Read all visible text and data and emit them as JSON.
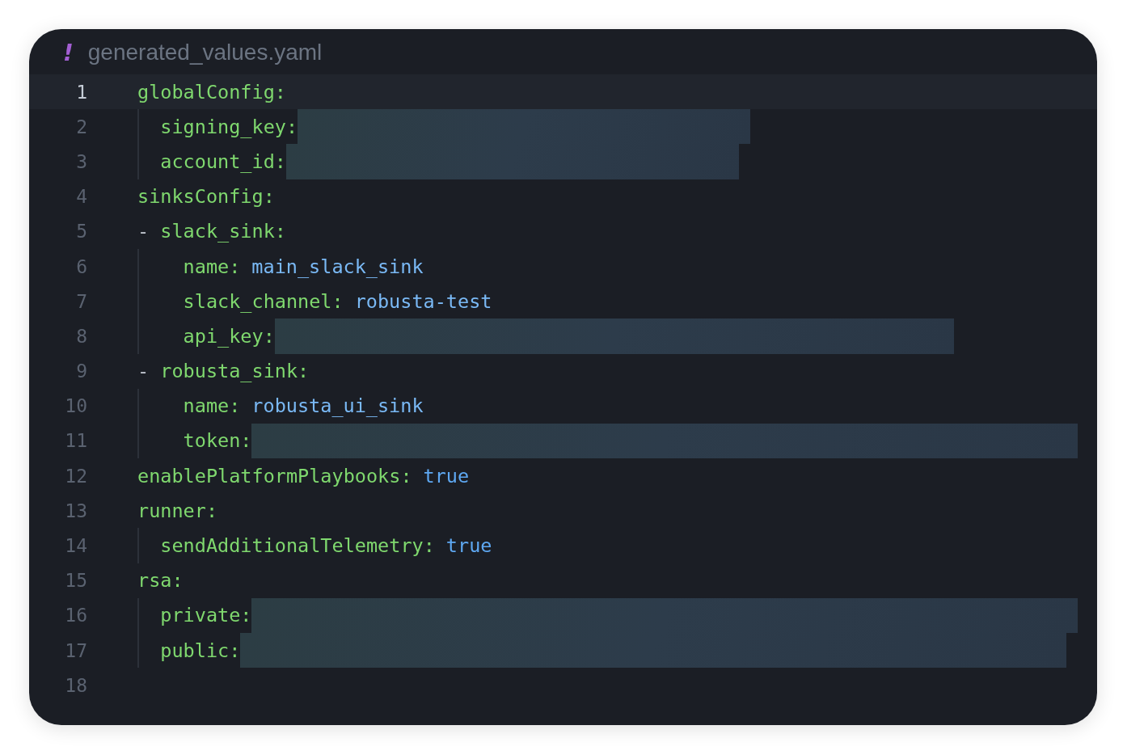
{
  "tab": {
    "icon": "!",
    "title": "generated_values.yaml"
  },
  "lines": [
    {
      "number": "1",
      "key": "globalConfig:",
      "current": true,
      "children": [
        {
          "number": "2",
          "key": "signing_key:",
          "kind": "short",
          "redacted": true,
          "current": false
        },
        {
          "number": "3",
          "key": "account_id:",
          "kind": "short",
          "redacted": true,
          "current": false
        }
      ]
    },
    {
      "number": "4",
      "key": "sinksConfig:",
      "current": false,
      "children": [
        {
          "number": "5",
          "dash": "-",
          "key": "slack_sink:",
          "current": false,
          "children": [
            {
              "number": "6",
              "key": "name:",
              "value": "main_slack_sink",
              "current": false
            },
            {
              "number": "7",
              "key": "slack_channel:",
              "value": "robusta-test",
              "current": false
            },
            {
              "number": "8",
              "key": "api_key:",
              "kind": "medium",
              "redacted": true,
              "current": false
            }
          ]
        },
        {
          "number": "9",
          "dash": "-",
          "key": "robusta_sink:",
          "current": false,
          "children": [
            {
              "number": "10",
              "key": "name:",
              "value": "robusta_ui_sink",
              "current": false
            },
            {
              "number": "11",
              "key": "token:",
              "kind": "long",
              "redacted": true,
              "current": false
            }
          ]
        }
      ]
    },
    {
      "number": "12",
      "key": "enablePlatformPlaybooks:",
      "value": "true",
      "current": false
    },
    {
      "number": "13",
      "key": "runner:",
      "current": false,
      "children": [
        {
          "number": "14",
          "key": "sendAdditionalTelemetry:",
          "value": "true",
          "current": false
        }
      ]
    },
    {
      "number": "15",
      "key": "rsa:",
      "current": false,
      "children": [
        {
          "number": "16",
          "key": "private:",
          "kind": "long",
          "redacted": true,
          "current": false
        },
        {
          "number": "17",
          "key": "public:",
          "kind": "long",
          "redacted": true,
          "current": false
        }
      ]
    },
    {
      "number": "18",
      "current": false
    }
  ]
}
